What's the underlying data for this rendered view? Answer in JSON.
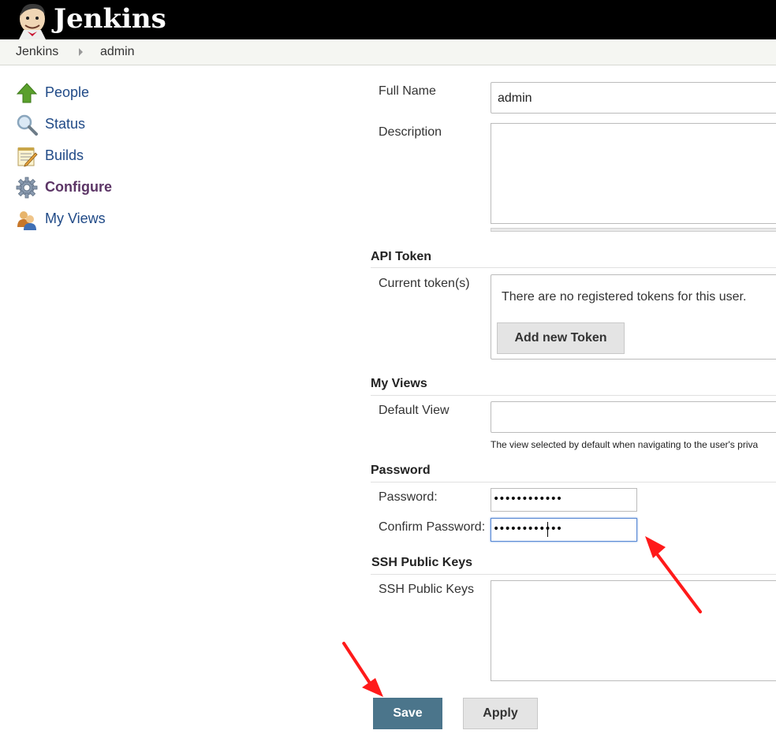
{
  "header": {
    "brand": "Jenkins"
  },
  "breadcrumbs": {
    "root": "Jenkins",
    "user": "admin"
  },
  "tasks": [
    {
      "label": "People",
      "icon": "up-arrow-icon"
    },
    {
      "label": "Status",
      "icon": "magnifier-icon"
    },
    {
      "label": "Builds",
      "icon": "notepad-icon"
    },
    {
      "label": "Configure",
      "icon": "gear-icon",
      "active": true
    },
    {
      "label": "My Views",
      "icon": "users-icon"
    }
  ],
  "form": {
    "full_name_label": "Full Name",
    "full_name_value": "admin",
    "description_label": "Description",
    "api_token": {
      "section": "API Token",
      "current_label": "Current token(s)",
      "empty_text": "There are no registered tokens for this user.",
      "add_button": "Add new Token"
    },
    "my_views": {
      "section": "My Views",
      "default_view_label": "Default View",
      "help": "The view selected by default when navigating to the user's priva"
    },
    "password": {
      "section": "Password",
      "password_label": "Password:",
      "password_value": "••••••••••••",
      "confirm_label": "Confirm Password:",
      "confirm_value": "••••••••••••"
    },
    "ssh": {
      "section": "SSH Public Keys",
      "label": "SSH Public Keys"
    }
  },
  "buttons": {
    "save": "Save",
    "apply": "Apply"
  },
  "colors": {
    "annotation_arrow": "#ff1a1a",
    "save_button": "#4b758b",
    "header": "#000000"
  }
}
